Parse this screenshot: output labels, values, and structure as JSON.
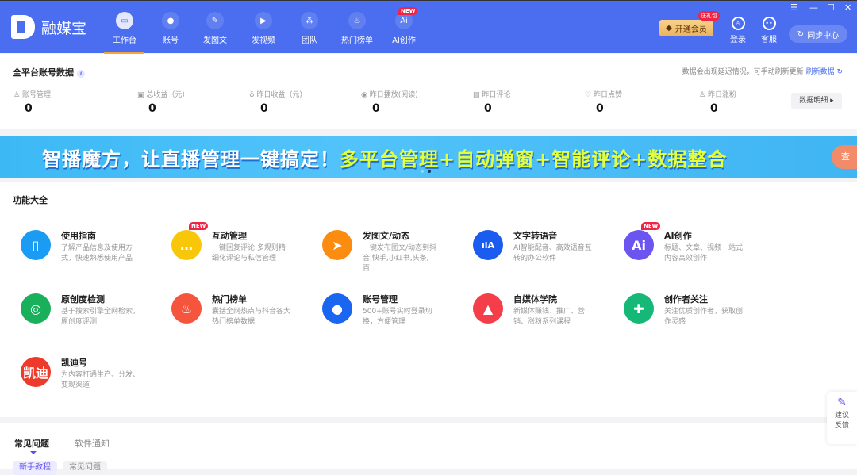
{
  "app": {
    "name": "融媒宝"
  },
  "nav": [
    {
      "label": "工作台",
      "icon": "monitor-icon",
      "glyph": "▭",
      "active": true
    },
    {
      "label": "账号",
      "icon": "user-icon",
      "glyph": "●"
    },
    {
      "label": "发图文",
      "icon": "feather-icon",
      "glyph": "✎"
    },
    {
      "label": "发视频",
      "icon": "play-icon",
      "glyph": "▶"
    },
    {
      "label": "团队",
      "icon": "team-icon",
      "glyph": "⁂"
    },
    {
      "label": "热门榜单",
      "icon": "fire-icon",
      "glyph": "♨"
    },
    {
      "label": "AI创作",
      "icon": "ai-icon",
      "glyph": "Ai",
      "badge": "NEW"
    }
  ],
  "header": {
    "vip_label": "开通会员",
    "gift_badge": "送礼包",
    "login": "登录",
    "service": "客服",
    "sync": "同步中心"
  },
  "stats": {
    "title": "全平台账号数据",
    "note": "数据会出现延迟情况，可手动刷新更新",
    "refresh": "刷新数据",
    "detail": "数据明细 ▸",
    "items": [
      {
        "label": "账号管理",
        "value": "0",
        "icon": "user-icon",
        "glyph": "♙"
      },
      {
        "label": "总收益（元）",
        "value": "0",
        "icon": "wallet-icon",
        "glyph": "▣"
      },
      {
        "label": "昨日收益（元）",
        "value": "0",
        "icon": "moneybag-icon",
        "glyph": "♁"
      },
      {
        "label": "昨日播放(阅读)",
        "value": "0",
        "icon": "play-circle-icon",
        "glyph": "◉"
      },
      {
        "label": "昨日评论",
        "value": "0",
        "icon": "comment-icon",
        "glyph": "▤"
      },
      {
        "label": "昨日点赞",
        "value": "0",
        "icon": "thumbs-up-icon",
        "glyph": "♡"
      },
      {
        "label": "昨日涨粉",
        "value": "0",
        "icon": "user-plus-icon",
        "glyph": "♙"
      }
    ]
  },
  "banner": {
    "text1": "智播魔方，让直播管理一键搞定！",
    "text2": "多平台管理+自动弹窗+智能评论+数据整合",
    "button": "查"
  },
  "features": {
    "title": "功能大全",
    "items": [
      {
        "title": "使用指南",
        "desc": "了解产品信息及使用方式，快速熟悉使用产品",
        "icon": "book-icon",
        "glyph": "▯",
        "color": "#1a9cf5"
      },
      {
        "title": "互动管理",
        "desc": "一键回复评论 多规则精细化评论与私信管理",
        "icon": "chat-icon",
        "glyph": "…",
        "color": "#f8c70a",
        "badge": "NEW"
      },
      {
        "title": "发图文/动态",
        "desc": "一键发布图文/动态到抖音,快手,小红书,头条,百...",
        "icon": "paper-plane-icon",
        "glyph": "➤",
        "color": "#fb8c10"
      },
      {
        "title": "文字转语音",
        "desc": "AI智能配音、高效语音互转的办公软件",
        "icon": "voice-icon",
        "glyph": "ılA",
        "color": "#1a5cf0"
      },
      {
        "title": "AI创作",
        "desc": "标题、文章、视频一站式内容高效创作",
        "icon": "ai-icon",
        "glyph": "Ai",
        "color": "#6a55f0",
        "badge": "NEW"
      },
      {
        "title": "原创度检测",
        "desc": "基于搜索引擎全网检索，原创度评测",
        "icon": "target-icon",
        "glyph": "◎",
        "color": "#18b05a"
      },
      {
        "title": "热门榜单",
        "desc": "囊括全网热点与抖音各大热门榜单数据",
        "icon": "fire-icon",
        "glyph": "♨",
        "color": "#f5553c"
      },
      {
        "title": "账号管理",
        "desc": "500+账号实时登录切换，方便管理",
        "icon": "user-icon",
        "glyph": "●",
        "color": "#1a66f0"
      },
      {
        "title": "自媒体学院",
        "desc": "新媒体赚钱、推广、营销、涨粉系列课程",
        "icon": "graduation-cap-icon",
        "glyph": "▲",
        "color": "#f43f4a"
      },
      {
        "title": "创作者关注",
        "desc": "关注优质创作者，获取创作灵感",
        "icon": "user-add-icon",
        "glyph": "✚",
        "color": "#16b878"
      },
      {
        "title": "凯迪号",
        "desc": "为内容打通生产、分发、变现渠道",
        "icon": "kaidi-logo-icon",
        "glyph": "凯迪",
        "color": "#ee3a2a"
      }
    ]
  },
  "faq": {
    "tabs": [
      "常见问题",
      "软件通知"
    ],
    "chips": [
      "新手教程",
      "常见问题"
    ]
  },
  "feedback": {
    "label1": "建议",
    "label2": "反馈"
  },
  "colors": {
    "header": "#4b6ef0",
    "accent": "#f6a33a"
  }
}
